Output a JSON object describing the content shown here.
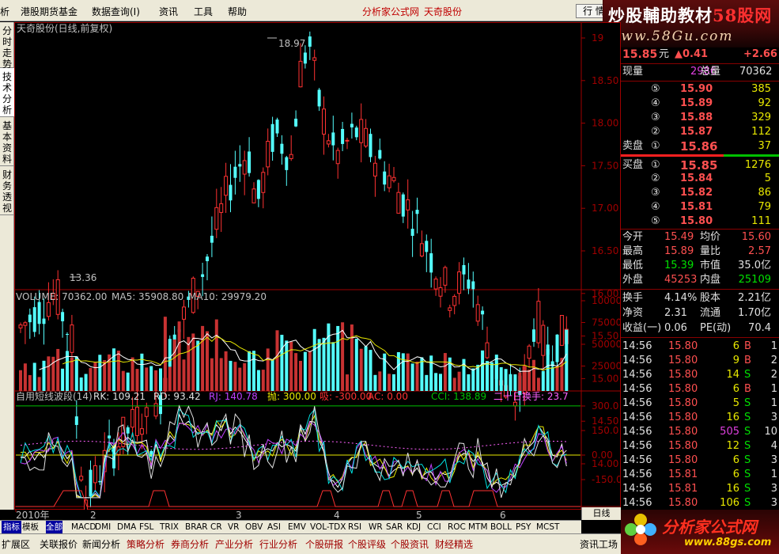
{
  "menu": {
    "items": [
      "析",
      "港股期货基金",
      "数据查询(I)",
      "资讯",
      "工具",
      "帮助"
    ],
    "center_links": [
      "分析家公式网",
      "天奇股份"
    ],
    "trade_button": "行 情"
  },
  "watermark_top": {
    "title_a": "炒股輔助教材",
    "title_b": "58股网",
    "url": "www.58Gu.com"
  },
  "left_tabs": [
    "分时走势",
    "技术分析",
    "基本资料",
    "财务透视"
  ],
  "main_chart": {
    "title": "天奇股份(日线,前复权)",
    "high_label": "18.97",
    "low_label": "13.36",
    "y_ticks": [
      "19",
      "18.50",
      "18.00",
      "17.50",
      "17.00",
      "16.50",
      "16.00",
      "15.50",
      "15.00",
      "14.50",
      "14.00"
    ]
  },
  "volume_chart": {
    "label_main": "VOLUME: 70362.00",
    "label_ma5": "MA5: 35908.80",
    "label_ma10": "MA10: 29979.20",
    "y_ticks": [
      "100000",
      "75000",
      "50000",
      "25000"
    ]
  },
  "indicator_chart": {
    "title": "自用短线波段(14)",
    "rk": "RK: 109.21",
    "rd": "RD: 93.42",
    "rj": "RJ: 140.78",
    "pao": "抛: 300.00",
    "xi": "吸: -300.00",
    "ac": "AC: 0.00",
    "cci": "CCI: 138.89",
    "turnover": "二十日换手: 23.7",
    "y_ticks": [
      "300.0",
      "150.0",
      "0.00",
      "-150.0"
    ]
  },
  "time_axis": {
    "year": "2010年",
    "months": [
      "2",
      "3",
      "4",
      "5",
      "6"
    ]
  },
  "period_label": "日线",
  "quote": {
    "price": "15.85",
    "price_unit": "元",
    "change": "▲0.41",
    "change_pct": "+2.66",
    "now_vol_label": "现量",
    "now_vol": "2986",
    "total_vol_label": "总量",
    "total_vol": "70362",
    "asks": [
      {
        "lvl": "⑤",
        "price": "15.90",
        "vol": "385"
      },
      {
        "lvl": "④",
        "price": "15.89",
        "vol": "92"
      },
      {
        "lvl": "③",
        "price": "15.88",
        "vol": "329"
      },
      {
        "lvl": "②",
        "price": "15.87",
        "vol": "112"
      }
    ],
    "ask1": {
      "label": "卖盘",
      "lvl": "①",
      "price": "15.86",
      "vol": "37"
    },
    "bid1": {
      "label": "买盘",
      "lvl": "①",
      "price": "15.85",
      "vol": "1276"
    },
    "bids": [
      {
        "lvl": "②",
        "price": "15.84",
        "vol": "5"
      },
      {
        "lvl": "③",
        "price": "15.82",
        "vol": "86"
      },
      {
        "lvl": "④",
        "price": "15.81",
        "vol": "79"
      },
      {
        "lvl": "⑤",
        "price": "15.80",
        "vol": "111"
      }
    ],
    "stats": [
      {
        "l1": "今开",
        "v1": "15.49",
        "l2": "均价",
        "v2": "15.60"
      },
      {
        "l1": "最高",
        "v1": "15.89",
        "l2": "量比",
        "v2": "2.57"
      },
      {
        "l1": "最低",
        "v1": "15.39",
        "l2": "市值",
        "v2": "35.0亿"
      },
      {
        "l1": "外盘",
        "v1": "45253",
        "l2": "内盘",
        "v2": "25109"
      }
    ],
    "stats2": [
      {
        "l1": "换手",
        "v1": "4.14%",
        "l2": "股本",
        "v2": "2.21亿"
      },
      {
        "l1": "净资",
        "v1": "2.31",
        "l2": "流通",
        "v2": "1.70亿"
      },
      {
        "l1": "收益(一)",
        "v1": "0.06",
        "l2": "PE(动)",
        "v2": "70.4"
      }
    ],
    "ticks": [
      {
        "t": "14:56",
        "p": "15.80",
        "v": "6",
        "s": "B",
        "n": "1"
      },
      {
        "t": "14:56",
        "p": "15.80",
        "v": "9",
        "s": "B",
        "n": "2"
      },
      {
        "t": "14:56",
        "p": "15.80",
        "v": "14",
        "s": "S",
        "n": "2"
      },
      {
        "t": "14:56",
        "p": "15.80",
        "v": "6",
        "s": "B",
        "n": "1"
      },
      {
        "t": "14:56",
        "p": "15.80",
        "v": "5",
        "s": "S",
        "n": "1"
      },
      {
        "t": "14:56",
        "p": "15.80",
        "v": "16",
        "s": "S",
        "n": "3"
      },
      {
        "t": "14:56",
        "p": "15.80",
        "v": "505",
        "s": "S",
        "n": "10"
      },
      {
        "t": "14:56",
        "p": "15.80",
        "v": "12",
        "s": "S",
        "n": "4"
      },
      {
        "t": "14:56",
        "p": "15.80",
        "v": "6",
        "s": "S",
        "n": "3"
      },
      {
        "t": "14:56",
        "p": "15.81",
        "v": "6",
        "s": "S",
        "n": "1"
      },
      {
        "t": "14:56",
        "p": "15.81",
        "v": "16",
        "s": "S",
        "n": "3"
      },
      {
        "t": "14:56",
        "p": "15.80",
        "v": "106",
        "s": "S",
        "n": "3"
      }
    ]
  },
  "indicator_tabs": [
    "指标",
    "模板",
    "全部",
    "MACD",
    "DMI",
    "DMA",
    "FSL",
    "TRIX",
    "BRAR",
    "CR",
    "VR",
    "OBV",
    "ASI",
    "EMV",
    "VOL-TDX",
    "RSI",
    "WR",
    "SAR",
    "KDJ",
    "CCI",
    "ROC",
    "MTM",
    "BOLL",
    "PSY",
    "MCST"
  ],
  "status_tabs": [
    "扩展区",
    "关联报价",
    "新闻分析",
    "策略分析",
    "券商分析",
    "产业分析",
    "行业分析",
    "个股研报",
    "个股评级",
    "个股资讯",
    "财经精选"
  ],
  "status_right": "资讯工场",
  "logo_bottom": {
    "text": "分析家公式网",
    "url": "www.88gs.com"
  },
  "colors": {
    "up": "#ff3232",
    "down": "#54ffff",
    "panel_border": "#a00000",
    "yellow": "#e8e800",
    "green": "#00e000"
  }
}
